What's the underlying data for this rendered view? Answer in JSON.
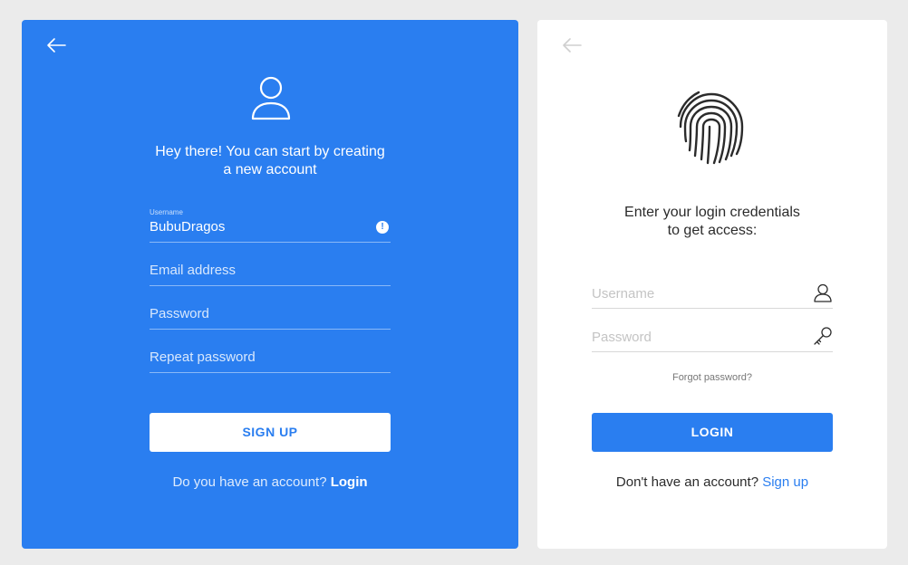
{
  "colors": {
    "accent": "#2a7ef0",
    "page_background": "#ebebeb",
    "card_white": "#ffffff"
  },
  "signup": {
    "back_icon": "arrow-left-icon",
    "hero_icon": "user-icon",
    "heading_line1": "Hey there! You can start by creating",
    "heading_line2": "a new account",
    "fields": {
      "username": {
        "label": "Username",
        "value": "BubuDragos",
        "icon": "info-icon"
      },
      "email": {
        "placeholder": "Email address"
      },
      "password": {
        "placeholder": "Password"
      },
      "repeat_password": {
        "placeholder": "Repeat password"
      }
    },
    "button_label": "SIGN UP",
    "switch_text": "Do you have an account?",
    "switch_link": "Login"
  },
  "login": {
    "back_icon": "arrow-left-icon",
    "hero_icon": "fingerprint-icon",
    "heading_line1": "Enter your login credentials",
    "heading_line2": "to get access:",
    "fields": {
      "username": {
        "placeholder": "Username",
        "icon": "user-icon"
      },
      "password": {
        "placeholder": "Password",
        "icon": "key-icon"
      }
    },
    "forgot_label": "Forgot password?",
    "button_label": "LOGIN",
    "switch_text": "Don't have an account?",
    "switch_link": "Sign up"
  }
}
